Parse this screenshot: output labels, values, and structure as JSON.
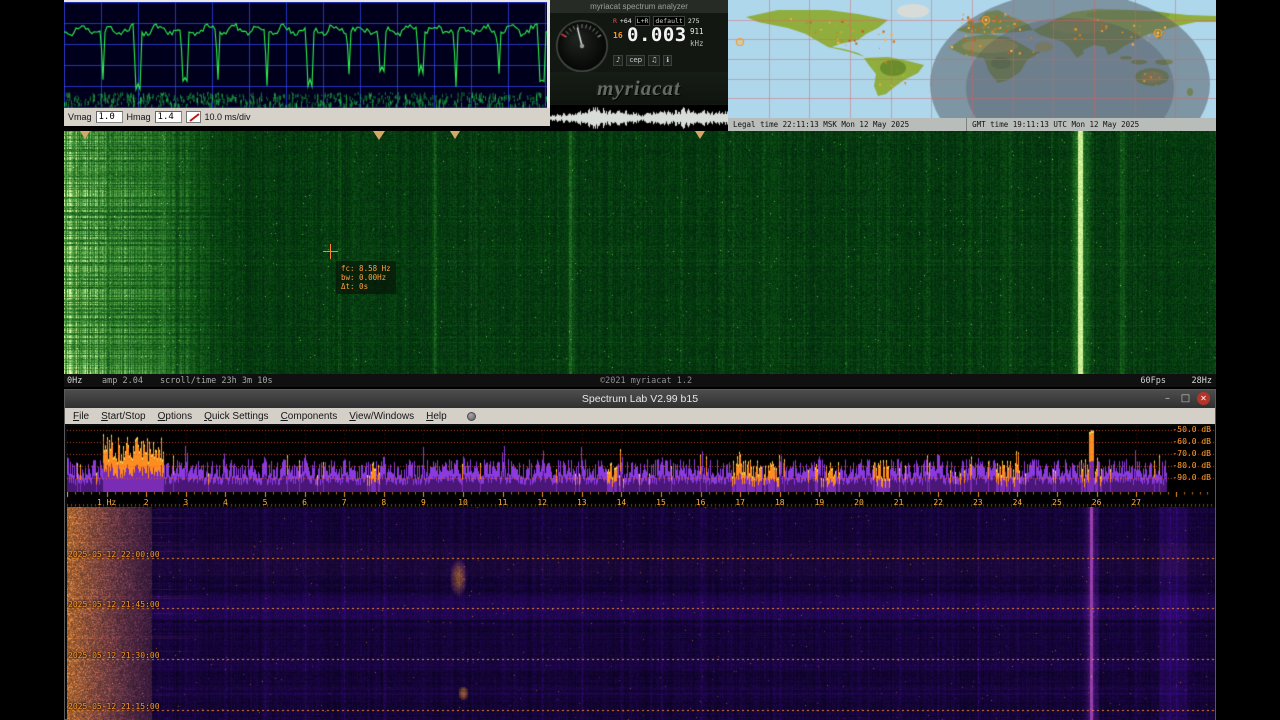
{
  "scope": {
    "vmag_label": "Vmag",
    "vmag_value": "1.0",
    "hmag_label": "Hmag",
    "hmag_value": "1.4",
    "timebase": "10.0 ms/div"
  },
  "analyzer": {
    "title": "myriacat spectrum analyzer",
    "r_indicator": "R",
    "gain": "+64",
    "channel": "L+R",
    "preset": "default",
    "rate": "275",
    "band": "16",
    "freq_main": "0.003",
    "freq_frac": "911",
    "freq_unit": "kHz",
    "btn_note1": "♪",
    "btn_cep": "cep",
    "btn_note2": "♫",
    "btn_info": "ℹ",
    "logo": "myriacat"
  },
  "map": {
    "legal_time": "Legal time 22:11:13 MSK Mon 12 May 2025",
    "gmt_time": "GMT time 19:11:13 UTC Mon 12 May 2025"
  },
  "waterfall": {
    "tooltip": {
      "fc": "fc: 8.58 Hz",
      "bw": "bw: 0.00Hz",
      "dt": "Δt: 0s"
    },
    "status": {
      "left_freq": "0Hz",
      "amp": "amp 2.04",
      "scroll": "scroll/time 23h 3m 10s",
      "copyright": "©2021 myriacat 1.2",
      "fps": "60Fps",
      "right_freq": "28Hz"
    }
  },
  "spectrum_lab": {
    "title": "Spectrum Lab V2.99 b15",
    "buttons": {
      "minimize": "–",
      "maximize": "□",
      "close": "✕"
    },
    "menu": [
      "File",
      "Start/Stop",
      "Options",
      "Quick Settings",
      "Components",
      "View/Windows",
      "Help"
    ],
    "db_labels": [
      "-50.0 dB",
      "-60.0 dB",
      "-70.0 dB",
      "-80.0 dB",
      "-90.0 dB"
    ],
    "freq_labels": [
      "1 Hz",
      "2",
      "3",
      "4",
      "5",
      "6",
      "7",
      "8",
      "9",
      "10",
      "11",
      "12",
      "13",
      "14",
      "15",
      "16",
      "17",
      "18",
      "19",
      "20",
      "21",
      "22",
      "23",
      "24",
      "25",
      "26",
      "27"
    ],
    "timestamps": [
      "2025-05-12 22:00:00",
      "2025-05-12 21:45:00",
      "2025-05-12 21:30:00",
      "2025-05-12 21:15:00"
    ]
  },
  "colors": {
    "accent_orange": "#ff8c28",
    "scope_trace": "#2ef04e",
    "waterfall_green": "#0a5a30",
    "lab_purple": "#6a28c8"
  }
}
